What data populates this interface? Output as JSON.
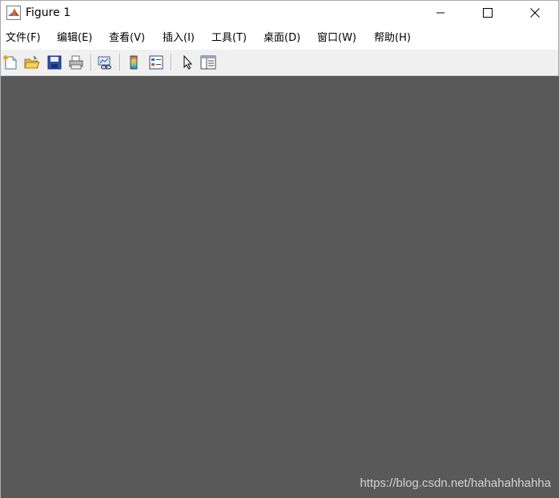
{
  "window": {
    "title": "Figure 1",
    "app_icon": "matlab-icon",
    "controls": [
      "minimize-icon",
      "maximize-icon",
      "close-icon"
    ]
  },
  "menu": [
    {
      "label": "文件(F)"
    },
    {
      "label": "编辑(E)"
    },
    {
      "label": "查看(V)"
    },
    {
      "label": "插入(I)"
    },
    {
      "label": "工具(T)"
    },
    {
      "label": "桌面(D)"
    },
    {
      "label": "窗口(W)"
    },
    {
      "label": "帮助(H)"
    }
  ],
  "toolbar": {
    "buttons": [
      "new-figure-icon",
      "open-file-icon",
      "save-icon",
      "print-icon",
      "link-plot-icon",
      "insert-colorbar-icon",
      "insert-legend-icon",
      "edit-plot-arrow-icon",
      "property-inspector-icon"
    ]
  },
  "canvas": {
    "background_color": "#595959"
  },
  "watermark": "https://blog.csdn.net/hahahahhahha"
}
